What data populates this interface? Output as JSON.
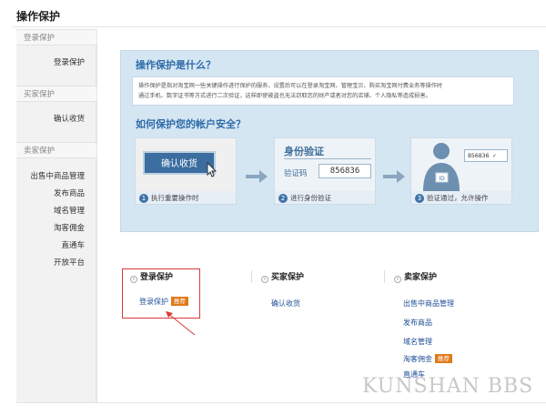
{
  "page": {
    "title": "操作保护"
  },
  "sidebar": {
    "sections": [
      {
        "heading": "登录保护",
        "items": [
          "登录保护"
        ]
      },
      {
        "heading": "买家保护",
        "items": [
          "确认收货"
        ]
      },
      {
        "heading": "卖家保护",
        "items": [
          "出售中商品管理",
          "发布商品",
          "域名管理",
          "淘客佣金",
          "直通车",
          "开放平台"
        ]
      }
    ]
  },
  "banner": {
    "question1": "操作保护是什么？",
    "description_line1": "操作保护是指对淘宝网一些关键操作进行保护的服务，设置后可以在登录淘宝网、管理宝贝、购买淘宝网付费业务等操作时",
    "description_line2": "通过手机、数字证书等方式进行二次验证，这样即使被盗也无法窃取您的财产或者对您的店铺、个人隐私等造成损害。",
    "question2": "如何保护您的帐户安全？",
    "steps": [
      {
        "num": "1",
        "caption": "执行重要操作时",
        "button": "确认收货"
      },
      {
        "num": "2",
        "caption": "进行身份验证",
        "title": "身份验证",
        "code_label": "验证码",
        "code": "856836"
      },
      {
        "num": "3",
        "caption": "验证通过，允许操作",
        "code": "856836 ✓",
        "id_text": "ID"
      }
    ]
  },
  "columns": {
    "login": {
      "heading": "登录保护",
      "link": "登录保护",
      "badge": "推荐"
    },
    "buyer": {
      "heading": "买家保护",
      "link": "确认收货"
    },
    "seller": {
      "heading": "卖家保护",
      "links": [
        "出售中商品管理",
        "发布商品",
        "域名管理",
        "淘客佣金",
        "直通车"
      ],
      "badge": "推荐"
    }
  },
  "watermark": "KUNSHAN BBS",
  "colors": {
    "accent": "#2e6ca8",
    "badge": "#e07a1a",
    "highlight": "#d93a3a",
    "link": "#1f4f95"
  }
}
